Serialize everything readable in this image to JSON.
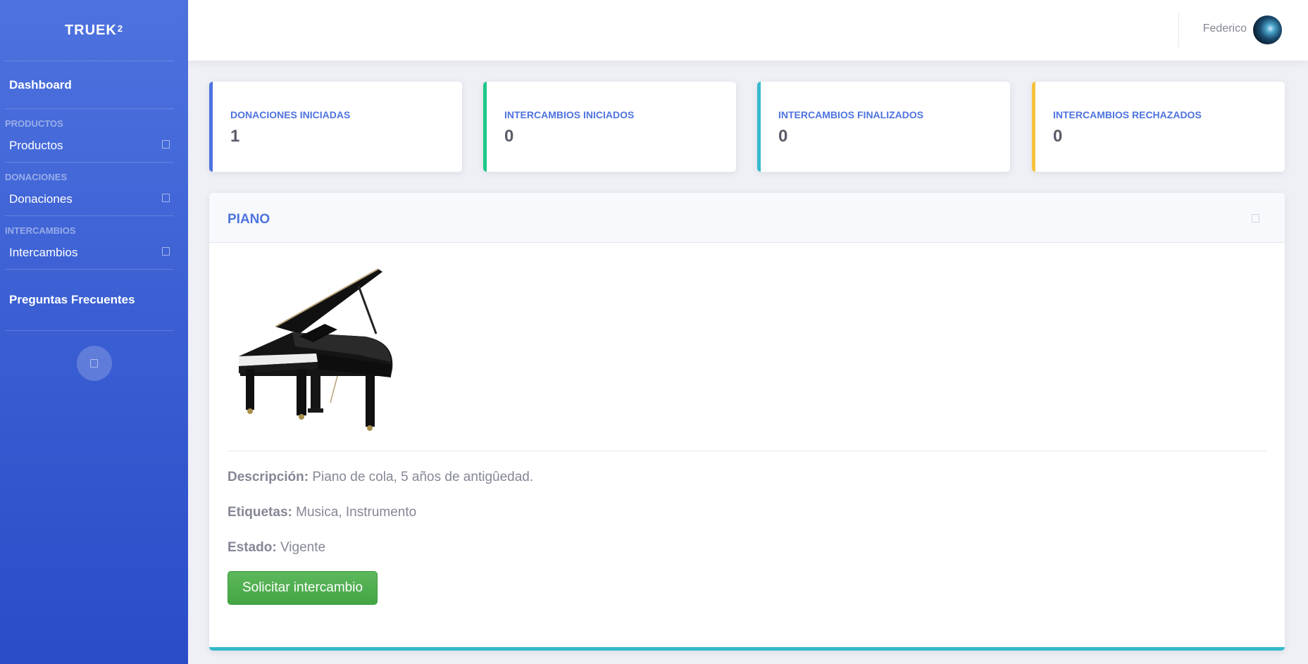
{
  "sidebar": {
    "brand": "TRUEK",
    "brand_sup": "2",
    "dashboard": "Dashboard",
    "sections": [
      {
        "heading": "PRODUCTOS",
        "item": "Productos"
      },
      {
        "heading": "DONACIONES",
        "item": "Donaciones"
      },
      {
        "heading": "INTERCAMBIOS",
        "item": "Intercambios"
      }
    ],
    "faq": "Preguntas Frecuentes"
  },
  "topbar": {
    "user_name": "Federico"
  },
  "stats": [
    {
      "label": "DONACIONES INICIADAS",
      "value": "1",
      "color": "#4e73df"
    },
    {
      "label": "INTERCAMBIOS INICIADOS",
      "value": "0",
      "color": "#1cc88a"
    },
    {
      "label": "INTERCAMBIOS FINALIZADOS",
      "value": "0",
      "color": "#36b9cc"
    },
    {
      "label": "INTERCAMBIOS RECHAZADOS",
      "value": "0",
      "color": "#f6c23e"
    }
  ],
  "product": {
    "title": "PIANO",
    "image_icon": "grand-piano-image",
    "description_label": "Descripción:",
    "description": "Piano de cola, 5 años de antigûedad.",
    "tags_label": "Etiquetas:",
    "tags": "Musica, Instrumento",
    "status_label": "Estado:",
    "status": "Vigente",
    "action_label": "Solicitar intercambio"
  },
  "colors": {
    "primary": "#4e73df",
    "success": "#1cc88a",
    "info": "#36b9cc",
    "warning": "#f6c23e",
    "button": "#4cae4c"
  }
}
